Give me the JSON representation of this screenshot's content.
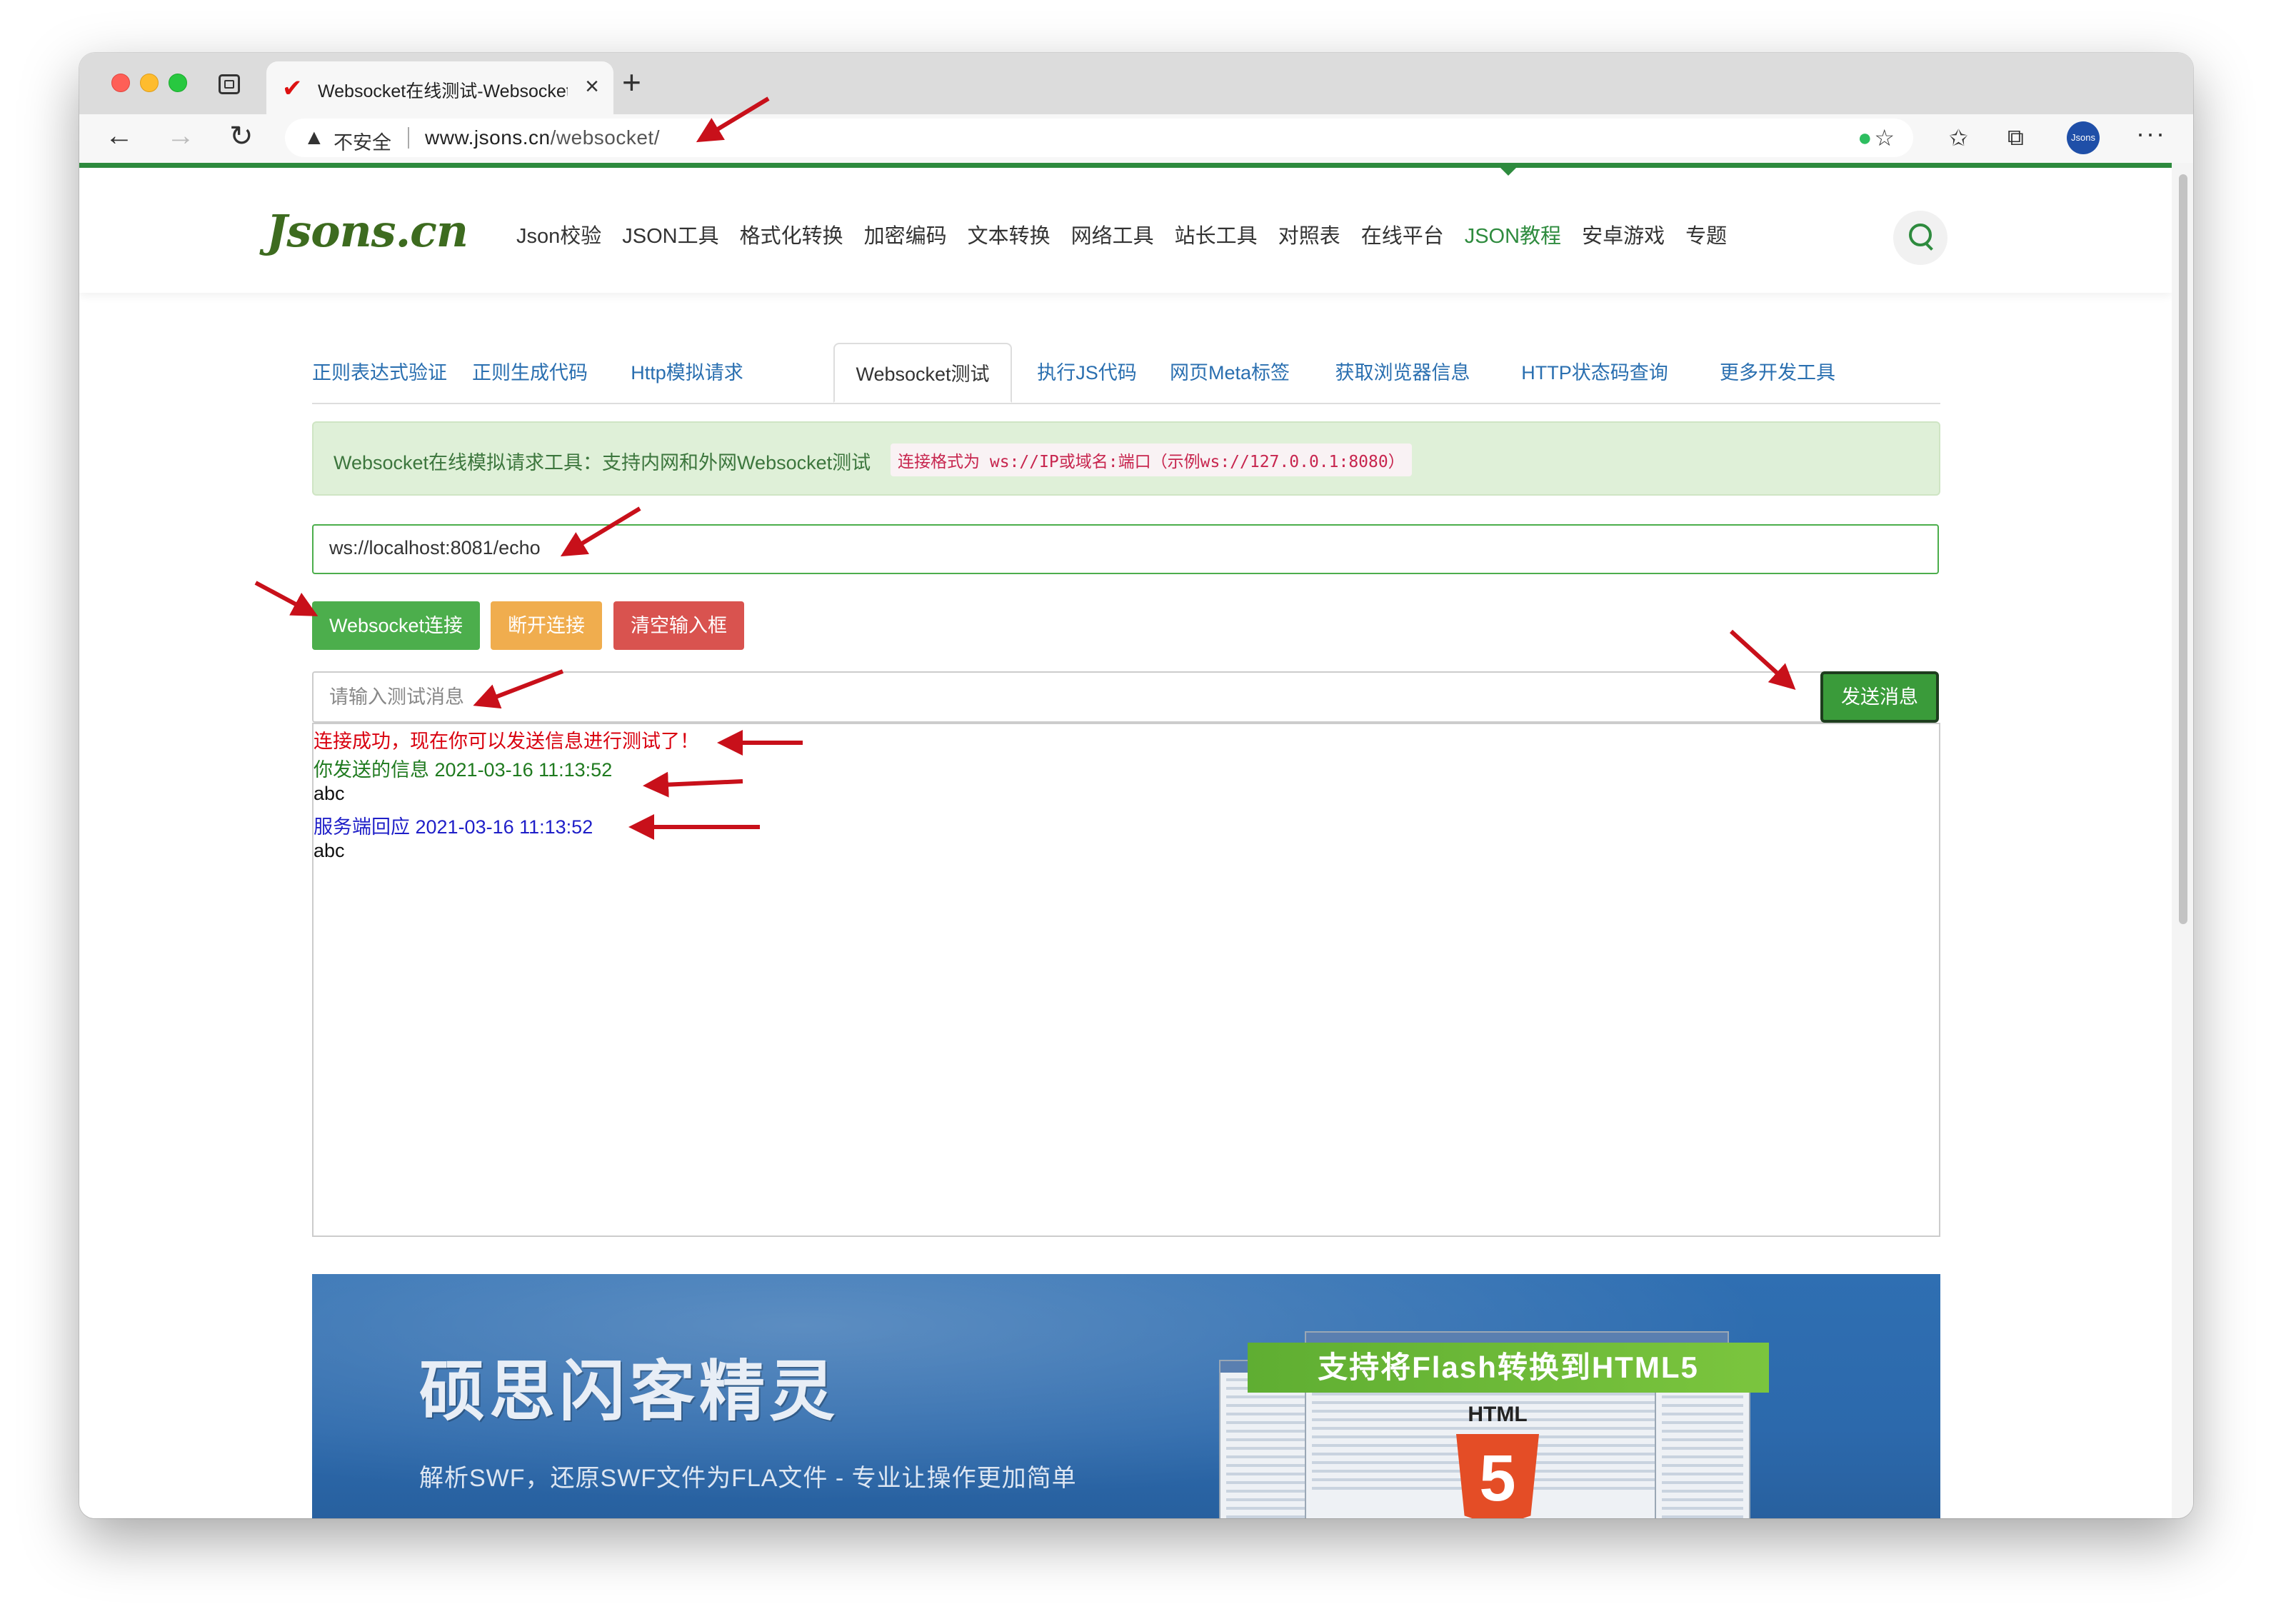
{
  "browser": {
    "tab_title": "Websocket在线测试-Websocket",
    "tab_close": "×",
    "new_tab": "+",
    "security_label": "不安全",
    "url_host": "www.jsons.cn",
    "url_path": "/websocket/",
    "profile_label": "Jsons"
  },
  "site": {
    "logo": "Jsons.cn",
    "nav": [
      "Json校验",
      "JSON工具",
      "格式化转换",
      "加密编码",
      "文本转换",
      "网络工具",
      "站长工具",
      "对照表",
      "在线平台",
      "JSON教程",
      "安卓游戏",
      "专题"
    ],
    "nav_active": "JSON教程"
  },
  "tool_tabs": [
    "正则表达式验证",
    "正则生成代码",
    "Http模拟请求",
    "Websocket测试",
    "执行JS代码",
    "网页Meta标签",
    "获取浏览器信息",
    "HTTP状态码查询",
    "更多开发工具"
  ],
  "active_tool_tab": "Websocket测试",
  "alert": {
    "text": "Websocket在线模拟请求工具：支持内网和外网Websocket测试",
    "code": "连接格式为 ws://IP或域名:端口（示例ws://127.0.0.1:8080）"
  },
  "ws_url_value": "ws://localhost:8081/echo",
  "buttons": {
    "connect": "Websocket连接",
    "disconnect": "断开连接",
    "clear": "清空输入框",
    "send": "发送消息"
  },
  "message_input_placeholder": "请输入测试消息",
  "log": [
    {
      "text": "连接成功，现在你可以发送信息进行测试了！",
      "color": "#d9000f"
    },
    {
      "text": "你发送的信息 2021-03-16 11:13:52",
      "color": "#1f7a1f"
    },
    {
      "text": "abc",
      "color": "#111111"
    },
    {
      "text": "服务端回应 2021-03-16 11:13:52",
      "color": "#1f1fc8"
    },
    {
      "text": "abc",
      "color": "#111111"
    }
  ],
  "banner": {
    "title": "硕思闪客精灵",
    "subtitle": "解析SWF，还原SWF文件为FLA文件 - 专业让操作更加简单",
    "ribbon": "支持将Flash转换到HTML5",
    "html5_label": "HTML",
    "html5_number": "5"
  },
  "colors": {
    "brand_green": "#2e8b3e",
    "connect_green": "#4cae4c",
    "disconnect_orange": "#f0ad4e",
    "clear_red": "#d9534f",
    "annotation_arrow": "#c8101a"
  }
}
